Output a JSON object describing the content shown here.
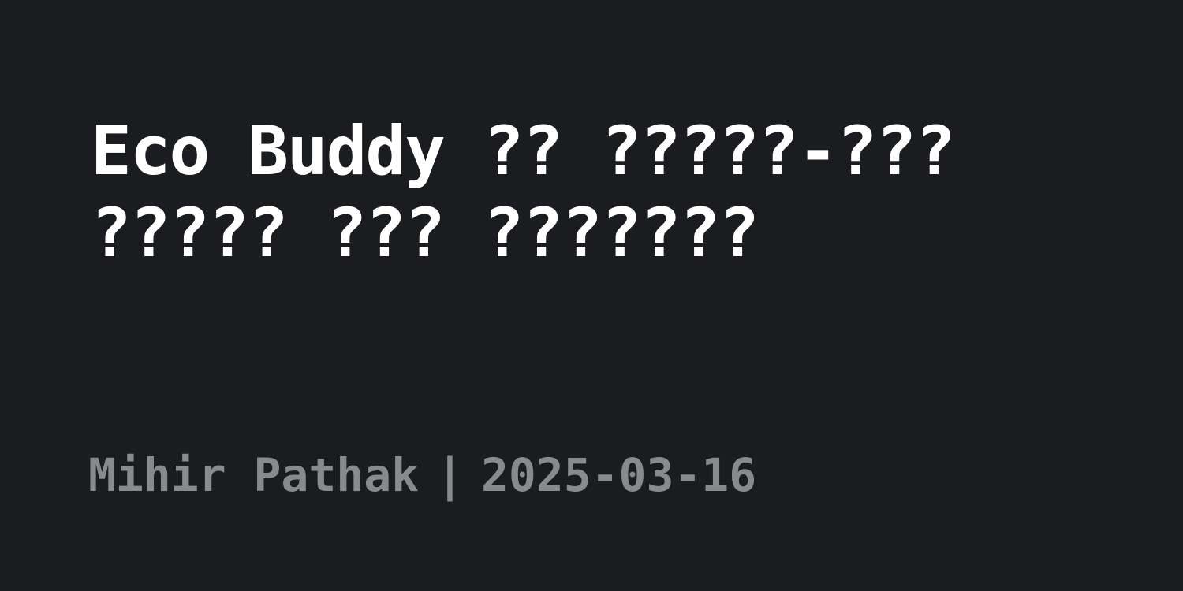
{
  "title": "Eco Buddy ?? ?????-??? ????? ??? ???????",
  "meta": {
    "author": "Mihir Pathak",
    "separator": "|",
    "date": "2025-03-16"
  },
  "colors": {
    "background": "#1b1c20",
    "title": "#ffffff",
    "meta": "#898a8e"
  }
}
